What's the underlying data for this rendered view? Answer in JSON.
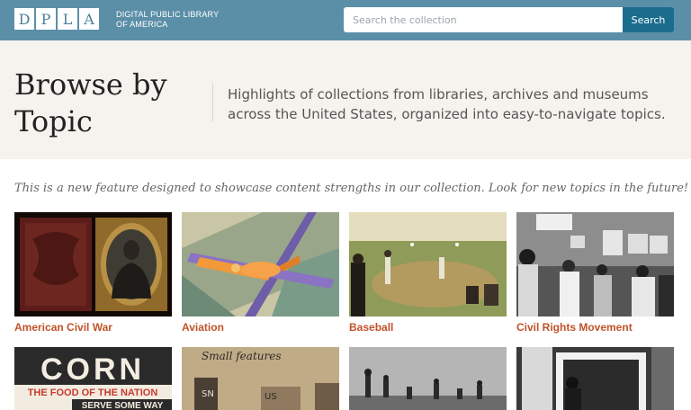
{
  "header": {
    "logo_letters": [
      "D",
      "P",
      "L",
      "A"
    ],
    "logo_line1": "DIGITAL PUBLIC LIBRARY",
    "logo_line2": "OF AMERICA",
    "search_placeholder": "Search the collection",
    "search_button": "Search",
    "bar_color": "#5b8fa8",
    "button_color": "#1b6d8e"
  },
  "hero": {
    "title_line1": "Browse by",
    "title_line2": "Topic",
    "description": "Highlights of collections from libraries, archives and museums across the United States, organized into easy-to-navigate topics."
  },
  "intro": "This is a new feature designed to showcase content strengths in our collection. Look for new topics in the future!",
  "topics": [
    {
      "label": "American Civil War",
      "image": "civil-war-portrait-image"
    },
    {
      "label": "Aviation",
      "image": "aviation-poster-image"
    },
    {
      "label": "Baseball",
      "image": "baseball-painting-image"
    },
    {
      "label": "Civil Rights Movement",
      "image": "civil-rights-march-image"
    },
    {
      "label": "",
      "image": "corn-poster-image"
    },
    {
      "label": "",
      "image": "immigration-document-image"
    },
    {
      "label": "",
      "image": "field-workers-photo-image"
    },
    {
      "label": "",
      "image": "interior-photo-image"
    }
  ],
  "poster_text": {
    "corn_title": "CORN",
    "corn_subtitle": "THE FOOD OF THE NATION",
    "corn_footer": "SERVE SOME WAY",
    "doc_script": "Small features",
    "doc_sn": "SN",
    "doc_us": "US"
  },
  "colors": {
    "topic_link": "#c0532a",
    "hero_background": "#f6f3ee"
  }
}
